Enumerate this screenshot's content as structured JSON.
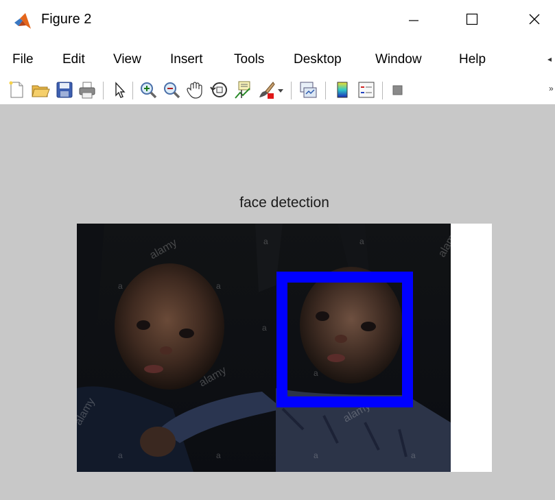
{
  "window": {
    "title": "Figure 2",
    "minimize_glyph": "–",
    "maximize_glyph": "☐",
    "close_glyph": "✕"
  },
  "menu": {
    "items": [
      "File",
      "Edit",
      "View",
      "Insert",
      "Tools",
      "Desktop",
      "Window",
      "Help"
    ]
  },
  "toolbar": {
    "icons": [
      "new-figure-icon",
      "open-file-icon",
      "save-icon",
      "print-icon",
      "pointer-icon",
      "zoom-in-icon",
      "zoom-out-icon",
      "pan-icon",
      "rotate-3d-icon",
      "data-cursor-icon",
      "brush-icon",
      "brush-dropdown-icon",
      "link-plot-icon",
      "colorbar-icon",
      "legend-icon",
      "plot-tools-icon"
    ]
  },
  "figure": {
    "title": "face detection",
    "detection_box_color": "#0000ff",
    "watermark_text": "alamy",
    "watermark_char": "a"
  },
  "colors": {
    "background": "#c8c8c8",
    "chrome": "#ffffff",
    "matlab_orange": "#e4661b"
  }
}
